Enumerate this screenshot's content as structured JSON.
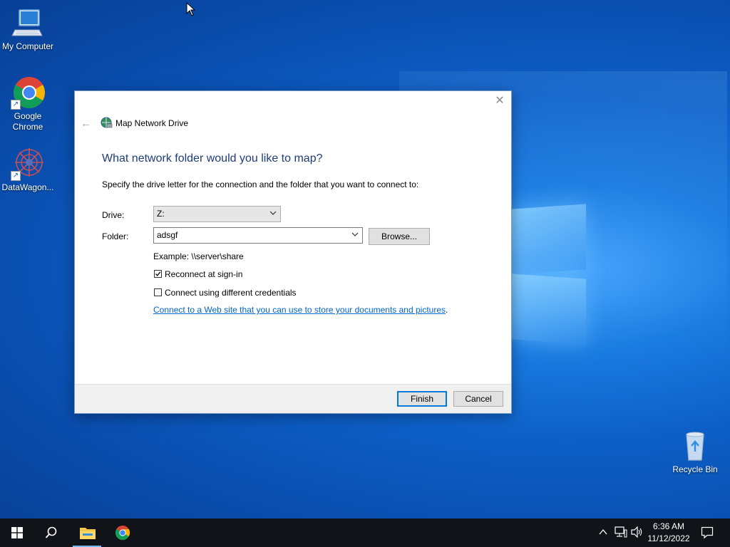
{
  "desktop": {
    "icons": [
      {
        "label": "My Computer"
      },
      {
        "label": "Google Chrome"
      },
      {
        "label": "DataWagon..."
      },
      {
        "label": "Recycle Bin"
      }
    ]
  },
  "dialog": {
    "title": "Map Network Drive",
    "heading": "What network folder would you like to map?",
    "instruction": "Specify the drive letter for the connection and the folder that you want to connect to:",
    "drive_label": "Drive:",
    "drive_value": "Z:",
    "folder_label": "Folder:",
    "folder_value": "adsgf",
    "browse_label": "Browse...",
    "example": "Example: \\\\server\\share",
    "reconnect_label": "Reconnect at sign-in",
    "reconnect_checked": true,
    "credentials_label": "Connect using different credentials",
    "credentials_checked": false,
    "link_text": "Connect to a Web site that you can use to store your documents and pictures",
    "link_period": ".",
    "finish_label": "Finish",
    "cancel_label": "Cancel"
  },
  "taskbar": {
    "time": "6:36 AM",
    "date": "11/12/2022"
  },
  "colors": {
    "heading": "#1e3c78",
    "link": "#0066cc",
    "taskbar": "#101418"
  }
}
